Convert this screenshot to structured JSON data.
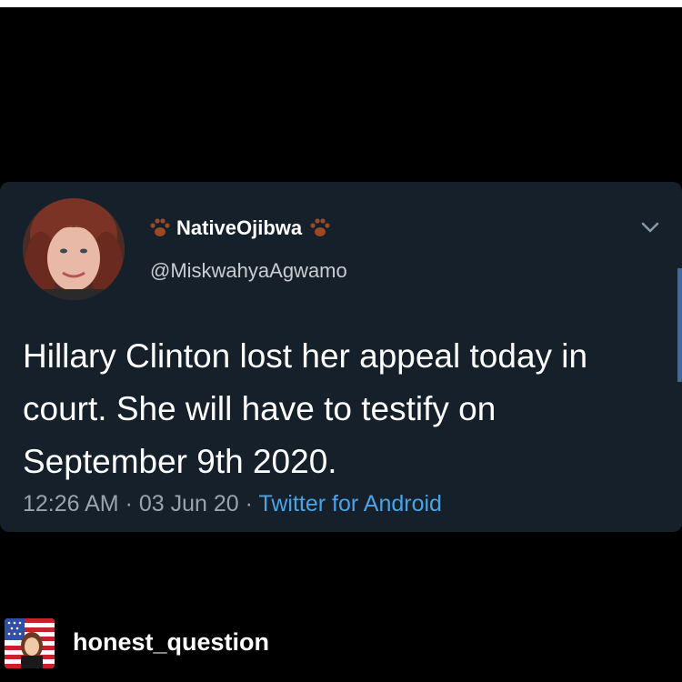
{
  "tweet": {
    "display_name": "NativeOjibwa",
    "handle": "@MiskwahyaAgwamo",
    "text": "Hillary Clinton lost her appeal today in court. She will have to testify on September 9th 2020.",
    "time": "12:26 AM",
    "date": "03 Jun 20",
    "separator": "·",
    "source": "Twitter for Android",
    "icons": {
      "menu": "chevron-down-icon",
      "name_decoration": "paw-print-icon"
    }
  },
  "repost": {
    "username": "honest_question"
  },
  "colors": {
    "background": "#000000",
    "card": "#15202b",
    "text": "#ffffff",
    "muted": "#9aa3ab",
    "link": "#4aa3e6"
  }
}
